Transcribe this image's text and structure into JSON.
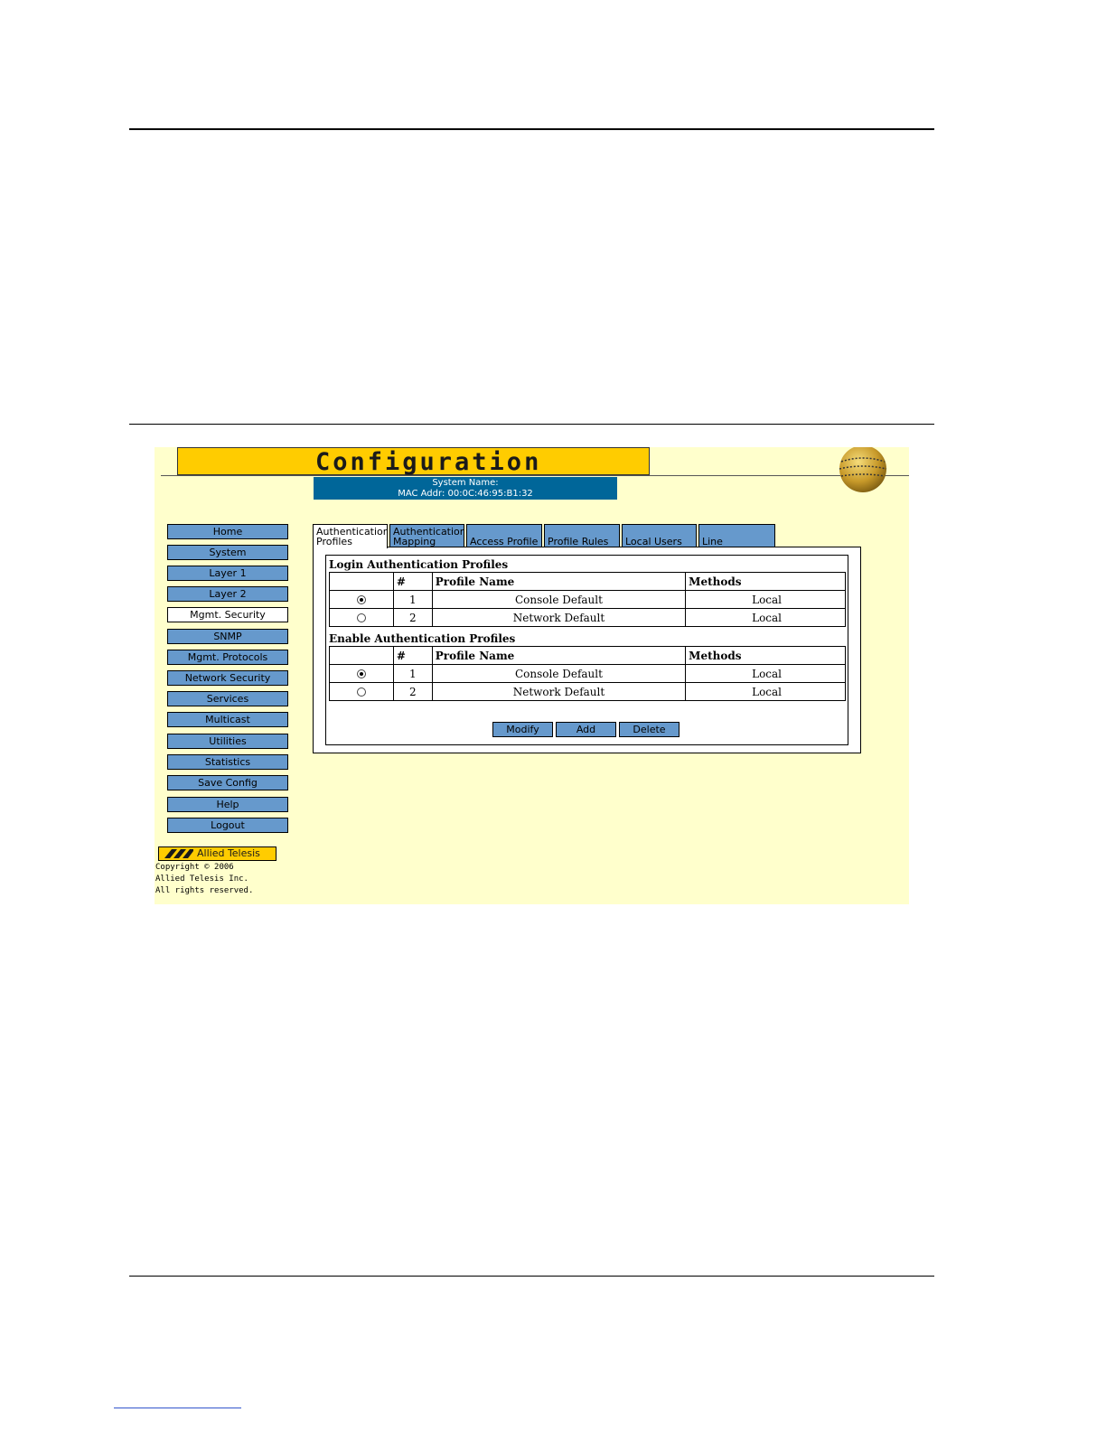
{
  "header": {
    "title": "Configuration",
    "system_name": "System Name:",
    "mac_addr": "MAC Addr: 00:0C:46:95:B1:32"
  },
  "sidebar": {
    "items": [
      {
        "label": "Home",
        "active": false
      },
      {
        "label": "System",
        "active": false
      },
      {
        "label": "Layer 1",
        "active": false
      },
      {
        "label": "Layer 2",
        "active": false
      },
      {
        "label": "Mgmt. Security",
        "active": true
      },
      {
        "label": "SNMP",
        "active": false
      },
      {
        "label": "Mgmt. Protocols",
        "active": false
      },
      {
        "label": "Network Security",
        "active": false
      },
      {
        "label": "Services",
        "active": false
      },
      {
        "label": "Multicast",
        "active": false
      },
      {
        "label": "Utilities",
        "active": false
      },
      {
        "label": "Statistics",
        "active": false
      },
      {
        "label": "Save Config",
        "active": false
      },
      {
        "label": "Help",
        "active": false
      },
      {
        "label": "Logout",
        "active": false
      }
    ]
  },
  "brand": {
    "name": "Allied Telesis",
    "copyright_line1": "Copyright © 2006",
    "copyright_line2": "Allied Telesis  Inc.",
    "copyright_line3": "All rights reserved."
  },
  "tabs": [
    {
      "line1": "Authentication",
      "line2": "Profiles",
      "active": true
    },
    {
      "line1": "Authentication",
      "line2": "Mapping",
      "active": false
    },
    {
      "line1": "",
      "line2": "Access Profile",
      "active": false
    },
    {
      "line1": "",
      "line2": "Profile Rules",
      "active": false
    },
    {
      "line1": "",
      "line2": "Local Users",
      "active": false
    },
    {
      "line1": "",
      "line2": "Line Password",
      "active": false
    }
  ],
  "login_profiles": {
    "title": "Login Authentication Profiles",
    "columns": [
      "",
      "#",
      "Profile Name",
      "Methods"
    ],
    "rows": [
      {
        "selected": true,
        "num": "1",
        "name": "Console Default",
        "methods": "Local"
      },
      {
        "selected": false,
        "num": "2",
        "name": "Network Default",
        "methods": "Local"
      }
    ]
  },
  "enable_profiles": {
    "title": "Enable Authentication Profiles",
    "columns": [
      "",
      "#",
      "Profile Name",
      "Methods"
    ],
    "rows": [
      {
        "selected": true,
        "num": "1",
        "name": "Console Default",
        "methods": "Local"
      },
      {
        "selected": false,
        "num": "2",
        "name": "Network Default",
        "methods": "Local"
      }
    ]
  },
  "actions": {
    "modify": "Modify",
    "add": "Add",
    "delete": "Delete"
  },
  "colors": {
    "background": "#ffffcc",
    "banner": "#ffcc00",
    "button": "#6699cc",
    "info_bar": "#006699"
  }
}
